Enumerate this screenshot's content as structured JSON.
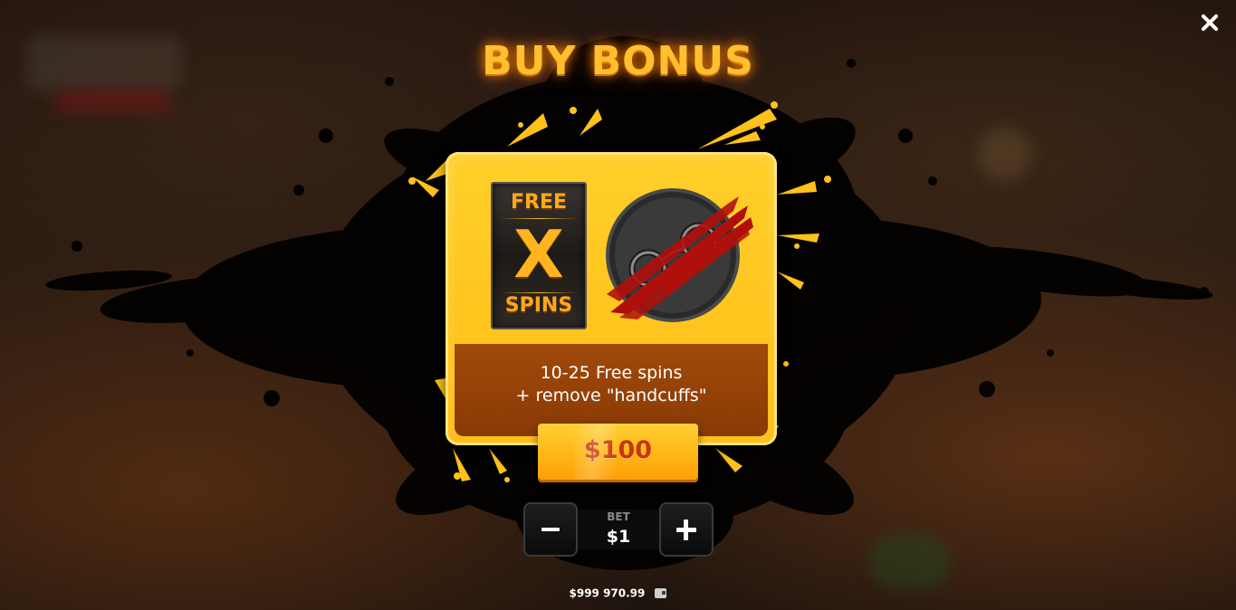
{
  "dialog": {
    "title": "BUY BONUS",
    "close_icon": "close-icon"
  },
  "bonus_card": {
    "symbol_words": {
      "top": "FREE",
      "middle": "X",
      "bottom": "SPINS"
    },
    "feature_icon": "handcuffs-icon",
    "description_line1": "10-25 Free spins",
    "description_line2": "+ remove \"handcuffs\"",
    "price": "$100"
  },
  "bet": {
    "label": "BET",
    "value": "$1",
    "minus_icon": "minus-icon",
    "plus_icon": "plus-icon"
  },
  "balance": {
    "amount": "$999 970.99",
    "icon": "wallet-icon"
  },
  "colors": {
    "title": "#ffbf2e",
    "card": "#ffc41c",
    "card_bottom": "#8a3a06",
    "price_text": "#c8360e",
    "slash": "#b0100c"
  }
}
